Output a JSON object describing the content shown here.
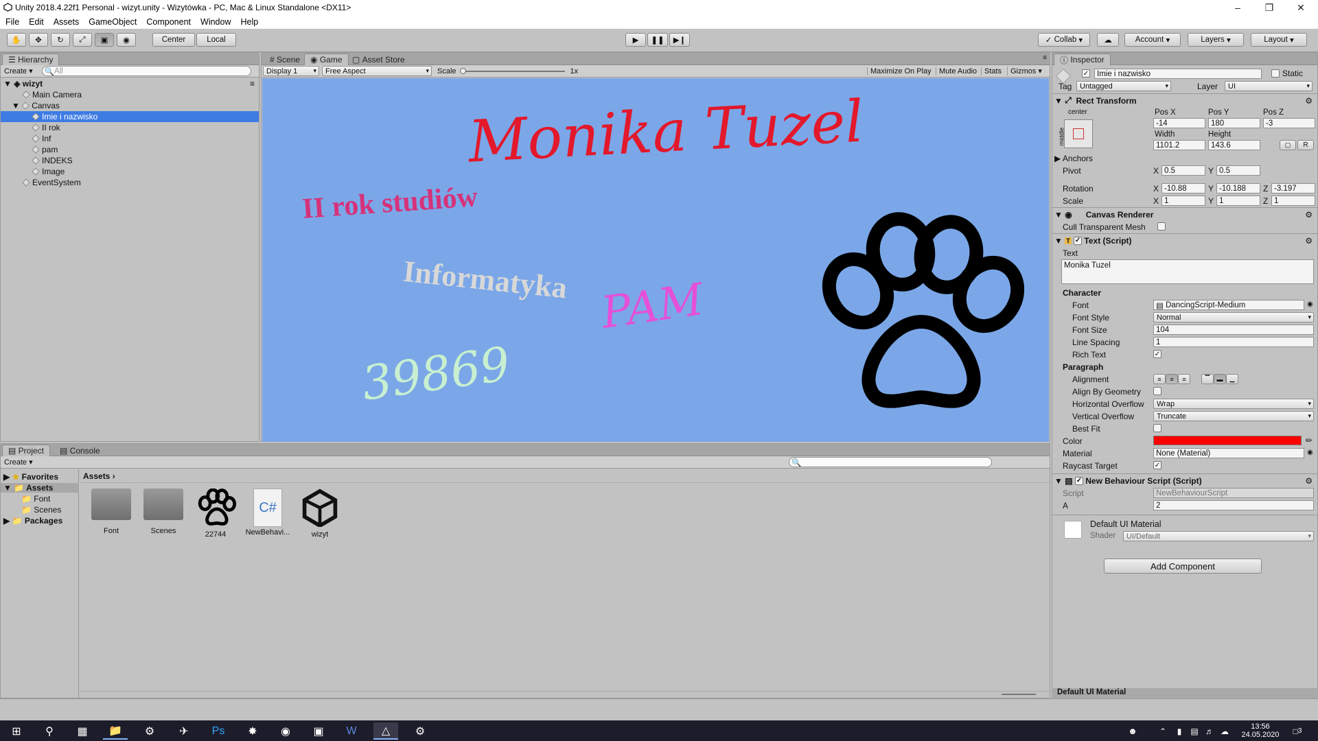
{
  "window": {
    "title": "Unity 2018.4.22f1 Personal - wizyt.unity - Wizytówka - PC, Mac & Linux Standalone <DX11>"
  },
  "menu": [
    "File",
    "Edit",
    "Assets",
    "GameObject",
    "Component",
    "Window",
    "Help"
  ],
  "toolbar": {
    "pivot_label": "Center",
    "space_label": "Local",
    "collab_label": "Collab",
    "account_label": "Account",
    "layers_label": "Layers",
    "layout_label": "Layout"
  },
  "hierarchy": {
    "tab": "Hierarchy",
    "create": "Create",
    "search_placeholder": "All",
    "scene": "wizyt",
    "items": [
      {
        "label": "Main Camera"
      },
      {
        "label": "Canvas"
      },
      {
        "label": "Imie i nazwisko"
      },
      {
        "label": "II rok"
      },
      {
        "label": "Inf"
      },
      {
        "label": "pam"
      },
      {
        "label": "INDEKS"
      },
      {
        "label": "Image"
      },
      {
        "label": "EventSystem"
      }
    ]
  },
  "game": {
    "tabs": [
      "Scene",
      "Game",
      "Asset Store"
    ],
    "display": "Display 1",
    "aspect": "Free Aspect",
    "scale_label": "Scale",
    "scale_value": "1x",
    "maximize": "Maximize On Play",
    "mute": "Mute Audio",
    "stats": "Stats",
    "gizmos": "Gizmos",
    "bg_color": "#7ba7e8",
    "texts": {
      "name": "Monika Tuzel",
      "year": "II rok studiów",
      "inf": "Informatyka",
      "pam": "PAM",
      "index": "39869"
    },
    "colors": {
      "name": "#e3182b",
      "year": "#d6327a",
      "inf": "#d8d8d8",
      "pam": "#e64fd8",
      "index": "#c8f0d0"
    }
  },
  "project": {
    "tabs": [
      "Project",
      "Console"
    ],
    "create": "Create",
    "favorites": "Favorites",
    "assets_root": "Assets",
    "folders": [
      "Font",
      "Scenes"
    ],
    "packages": "Packages",
    "breadcrumb": "Assets",
    "assets": [
      {
        "label": "Font",
        "icon": "folder-icon"
      },
      {
        "label": "Scenes",
        "icon": "folder-icon"
      },
      {
        "label": "22744",
        "icon": "paw-icon"
      },
      {
        "label": "NewBehavi...",
        "icon": "csharp-icon"
      },
      {
        "label": "wizyt",
        "icon": "unity-icon"
      }
    ]
  },
  "inspector": {
    "tab": "Inspector",
    "object_name": "Imie i nazwisko",
    "static": "Static",
    "tag_label": "Tag",
    "tag": "Untagged",
    "layer_label": "Layer",
    "layer": "UI",
    "rect": {
      "title": "Rect Transform",
      "anchor_h": "center",
      "anchor_v": "middle",
      "posx_label": "Pos X",
      "posy_label": "Pos Y",
      "posz_label": "Pos Z",
      "posx": "-14",
      "posy": "180",
      "posz": "-3",
      "width_label": "Width",
      "height_label": "Height",
      "width": "1101.2",
      "height": "143.6",
      "anchors": "Anchors",
      "pivot": "Pivot",
      "pivot_x": "0.5",
      "pivot_y": "0.5",
      "rotation": "Rotation",
      "rot_x": "-10.88",
      "rot_y": "-10.188",
      "rot_z": "-3.197",
      "scale": "Scale",
      "sc_x": "1",
      "sc_y": "1",
      "sc_z": "1",
      "r_btn": "R"
    },
    "canvas_renderer": {
      "title": "Canvas Renderer",
      "cull": "Cull Transparent Mesh"
    },
    "text_script": {
      "title": "Text (Script)",
      "text_label": "Text",
      "text_value": "Monika Tuzel",
      "character": "Character",
      "font_label": "Font",
      "font": "DancingScript-Medium",
      "font_style_label": "Font Style",
      "font_style": "Normal",
      "font_size_label": "Font Size",
      "font_size": "104",
      "line_spacing_label": "Line Spacing",
      "line_spacing": "1",
      "rich_text_label": "Rich Text",
      "paragraph": "Paragraph",
      "alignment_label": "Alignment",
      "align_geom_label": "Align By Geometry",
      "h_overflow_label": "Horizontal Overflow",
      "h_overflow": "Wrap",
      "v_overflow_label": "Vertical Overflow",
      "v_overflow": "Truncate",
      "best_fit_label": "Best Fit",
      "color_label": "Color",
      "color": "#ff0000",
      "material_label": "Material",
      "material": "None (Material)",
      "raycast_label": "Raycast Target"
    },
    "behaviour": {
      "title": "New Behaviour Script (Script)",
      "script_label": "Script",
      "script": "NewBehaviourScript",
      "a_label": "A",
      "a_value": "2"
    },
    "material": {
      "title": "Default UI Material",
      "shader_label": "Shader",
      "shader": "UI/Default"
    },
    "add_component": "Add Component",
    "footer": "Default UI Material"
  },
  "taskbar": {
    "time": "13:56",
    "date": "24.05.2020",
    "notif": "3"
  }
}
